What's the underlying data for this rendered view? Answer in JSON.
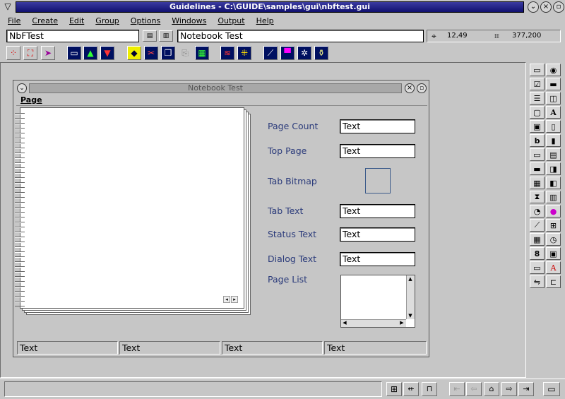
{
  "window": {
    "title": "Guidelines - C:\\GUIDE\\samples\\gui\\nbftest.gui"
  },
  "menu": [
    {
      "label": "File"
    },
    {
      "label": "Create"
    },
    {
      "label": "Edit"
    },
    {
      "label": "Group"
    },
    {
      "label": "Options"
    },
    {
      "label": "Windows"
    },
    {
      "label": "Output"
    },
    {
      "label": "Help"
    }
  ],
  "toolbar": {
    "object_name": "NbFTest",
    "object_title": "Notebook Test",
    "position": "12,49",
    "size": "377,200"
  },
  "notebook_window": {
    "title": "Notebook Test",
    "menu_label": "Page",
    "labels": {
      "page_count": "Page Count",
      "top_page": "Top Page",
      "tab_bitmap": "Tab Bitmap",
      "tab_text": "Tab Text",
      "status_text": "Status Text",
      "dialog_text": "Dialog Text",
      "page_list": "Page List"
    },
    "values": {
      "page_count": "Text",
      "top_page": "Text",
      "tab_text": "Text",
      "status_text": "Text",
      "dialog_text": "Text"
    },
    "status": [
      "Text",
      "Text",
      "Text",
      "Text"
    ]
  },
  "colors": {
    "titlebar": "#101070",
    "label": "#2a3a7a",
    "background": "#c6c6c6"
  }
}
